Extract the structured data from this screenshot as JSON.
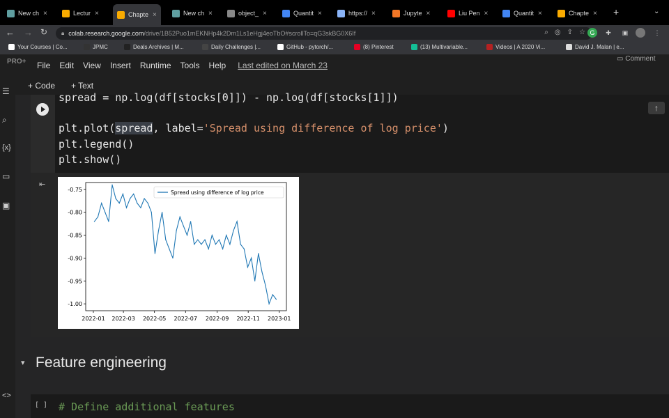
{
  "browser": {
    "tabs": [
      {
        "label": "New ch",
        "color": "#5f9ea0"
      },
      {
        "label": "Lectur",
        "color": "#f9ab00"
      },
      {
        "label": "Chapte",
        "color": "#f9ab00",
        "active": true
      },
      {
        "label": "New ch",
        "color": "#5f9ea0"
      },
      {
        "label": "object_",
        "color": "#888888"
      },
      {
        "label": "Quantit",
        "color": "#4285f4"
      },
      {
        "label": "https://",
        "color": "#8ab4f8"
      },
      {
        "label": "Jupyte",
        "color": "#f37726"
      },
      {
        "label": "Liu Pen",
        "color": "#ff0000"
      },
      {
        "label": "Quantit",
        "color": "#4285f4"
      },
      {
        "label": "Chapte",
        "color": "#f9ab00"
      }
    ],
    "url_host": "colab.research.google.com",
    "url_path": "/drive/1B52Puo1mEKNHp4k2Dm1Ls1eHgj4eoTbO#scrollTo=qG3skBG0X6If",
    "bookmarks": [
      {
        "label": "Your Courses | Co...",
        "color": "#ffffff"
      },
      {
        "label": "JPMC",
        "color": "#333333"
      },
      {
        "label": "Deals Archives | M...",
        "color": "#222222"
      },
      {
        "label": "Daily Challenges |...",
        "color": "#444444"
      },
      {
        "label": "GitHub - pytorch/...",
        "color": "#ffffff"
      },
      {
        "label": "(8) Pinterest",
        "color": "#e60023"
      },
      {
        "label": "(13) Multivariable...",
        "color": "#14bf96"
      },
      {
        "label": "Videos | A 2020 Vi...",
        "color": "#b52121"
      },
      {
        "label": "David J. Malan | e...",
        "color": "#dddddd"
      }
    ]
  },
  "colab": {
    "badge": "PRO+",
    "menu": [
      "File",
      "Edit",
      "View",
      "Insert",
      "Runtime",
      "Tools",
      "Help"
    ],
    "last_edited": "Last edited on March 23",
    "comment_label": "Comment",
    "add_code": "+ Code",
    "add_text": "+ Text",
    "code_lines": {
      "line1": "spread = np.log(df[stocks[0]]) - np.log(df[stocks[1]])",
      "line2_a": "plt.plot(",
      "line2_hl": "spread",
      "line2_b": ", label=",
      "line2_str": "'Spread using difference of log price'",
      "line2_c": ")",
      "line3": "plt.legend()",
      "line4": "plt.show()"
    },
    "section_title": "Feature engineering",
    "cell2_bracket": "[ ]",
    "cell2_comment": "# Define additional features"
  },
  "chart_data": {
    "type": "line",
    "title": "",
    "xlabel": "",
    "ylabel": "",
    "x_ticks": [
      "2022-01",
      "2022-03",
      "2022-05",
      "2022-07",
      "2022-09",
      "2022-11",
      "2023-01"
    ],
    "y_ticks": [
      "-0.75",
      "-0.80",
      "-0.85",
      "-0.90",
      "-0.95",
      "-1.00"
    ],
    "ylim": [
      -1.015,
      -0.735
    ],
    "xlim": [
      "2021-12-17",
      "2023-01-15"
    ],
    "legend": "top-right",
    "line_color": "#1f77b4",
    "series": [
      {
        "name": "Spread using difference of log price",
        "x": [
          "2022-01-03",
          "2022-01-10",
          "2022-01-17",
          "2022-01-24",
          "2022-01-31",
          "2022-02-07",
          "2022-02-14",
          "2022-02-21",
          "2022-02-28",
          "2022-03-07",
          "2022-03-14",
          "2022-03-21",
          "2022-03-28",
          "2022-04-04",
          "2022-04-11",
          "2022-04-18",
          "2022-04-25",
          "2022-05-02",
          "2022-05-09",
          "2022-05-16",
          "2022-05-23",
          "2022-05-30",
          "2022-06-06",
          "2022-06-13",
          "2022-06-20",
          "2022-06-27",
          "2022-07-04",
          "2022-07-11",
          "2022-07-18",
          "2022-07-25",
          "2022-08-01",
          "2022-08-08",
          "2022-08-15",
          "2022-08-22",
          "2022-08-29",
          "2022-09-05",
          "2022-09-12",
          "2022-09-19",
          "2022-09-26",
          "2022-10-03",
          "2022-10-10",
          "2022-10-17",
          "2022-10-24",
          "2022-10-31",
          "2022-11-07",
          "2022-11-14",
          "2022-11-21",
          "2022-11-28",
          "2022-12-05",
          "2022-12-12",
          "2022-12-19",
          "2022-12-26"
        ],
        "values": [
          -0.82,
          -0.81,
          -0.78,
          -0.8,
          -0.82,
          -0.74,
          -0.77,
          -0.78,
          -0.76,
          -0.79,
          -0.77,
          -0.76,
          -0.78,
          -0.79,
          -0.77,
          -0.78,
          -0.8,
          -0.89,
          -0.84,
          -0.8,
          -0.86,
          -0.88,
          -0.9,
          -0.84,
          -0.81,
          -0.83,
          -0.85,
          -0.82,
          -0.87,
          -0.86,
          -0.87,
          -0.86,
          -0.88,
          -0.85,
          -0.87,
          -0.86,
          -0.88,
          -0.85,
          -0.87,
          -0.84,
          -0.82,
          -0.87,
          -0.88,
          -0.92,
          -0.9,
          -0.95,
          -0.89,
          -0.93,
          -0.96,
          -1.0,
          -0.98,
          -0.99
        ]
      }
    ]
  }
}
